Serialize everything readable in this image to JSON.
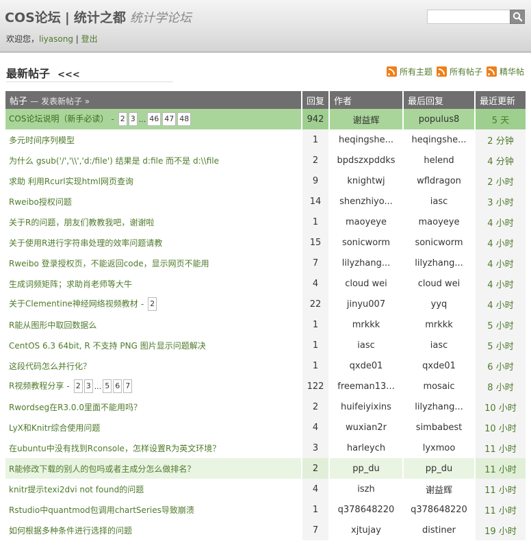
{
  "header": {
    "brand": "COS论坛",
    "separator": "|",
    "subtitle": "统计之都",
    "slogan": "统计学论坛",
    "welcome": "欢迎您，",
    "username": "liyasong",
    "divider": "|",
    "logout": "登出",
    "search_placeholder": ""
  },
  "section": {
    "title": "最新帖子",
    "more": "<<<"
  },
  "feeds": [
    {
      "label": "所有主题"
    },
    {
      "label": "所有帖子"
    },
    {
      "label": "精华帖"
    }
  ],
  "table": {
    "columns": {
      "topic": "帖子",
      "new_post": "— 发表新帖子 »",
      "replies": "回复",
      "author": "作者",
      "last_reply": "最后回复",
      "updated": "最近更新"
    },
    "rows": [
      {
        "title": "COS论坛说明（新手必读）",
        "pages": [
          "2",
          "3",
          "...",
          "46",
          "47",
          "48"
        ],
        "replies": "942",
        "author": "谢益辉",
        "last": "populus8",
        "updated": "5 天",
        "style": "pinned"
      },
      {
        "title": "多元时间序列模型",
        "pages": [],
        "replies": "1",
        "author": "heqingshe...",
        "last": "heqingshe...",
        "updated": "2 分钟",
        "style": ""
      },
      {
        "title": "为什么 gsub('/','\\\\','d:/file') 结果是 d:file 而不是 d:\\\\file",
        "pages": [],
        "replies": "2",
        "author": "bpdszxpddks",
        "last": "helend",
        "updated": "4 分钟",
        "style": ""
      },
      {
        "title": "求助 利用Rcurl实现html网页查询",
        "pages": [],
        "replies": "9",
        "author": "knightwj",
        "last": "wfldragon",
        "updated": "2 小时",
        "style": ""
      },
      {
        "title": "Rweibo授权问题",
        "pages": [],
        "replies": "14",
        "author": "shenzhiyo...",
        "last": "iasc",
        "updated": "3 小时",
        "style": ""
      },
      {
        "title": "关于R的问题，朋友们教教我吧，谢谢啦",
        "pages": [],
        "replies": "1",
        "author": "maoyeye",
        "last": "maoyeye",
        "updated": "4 小时",
        "style": ""
      },
      {
        "title": "关于使用R进行字符串处理的效率问题请教",
        "pages": [],
        "replies": "15",
        "author": "sonicworm",
        "last": "sonicworm",
        "updated": "4 小时",
        "style": ""
      },
      {
        "title": "Rweibo 登录授权页，不能返回code，显示网页不能用",
        "pages": [],
        "replies": "7",
        "author": "lilyzhang...",
        "last": "lilyzhang...",
        "updated": "4 小时",
        "style": ""
      },
      {
        "title": "生成词频矩阵；求助肖老师等大牛",
        "pages": [],
        "replies": "4",
        "author": "cloud wei",
        "last": "cloud wei",
        "updated": "4 小时",
        "style": ""
      },
      {
        "title": "关于Clementine神经网络视频教材",
        "pages": [
          "2"
        ],
        "replies": "22",
        "author": "jinyu007",
        "last": "yyq",
        "updated": "4 小时",
        "style": ""
      },
      {
        "title": "R能从图形中取回数据么",
        "pages": [],
        "replies": "1",
        "author": "mrkkk",
        "last": "mrkkk",
        "updated": "5 小时",
        "style": ""
      },
      {
        "title": "CentOS 6.3 64bit, R 不支持 PNG 图片显示问题解决",
        "pages": [],
        "replies": "1",
        "author": "iasc",
        "last": "iasc",
        "updated": "5 小时",
        "style": ""
      },
      {
        "title": "这段代码怎么并行化？",
        "pages": [],
        "replies": "1",
        "author": "qxde01",
        "last": "qxde01",
        "updated": "6 小时",
        "style": ""
      },
      {
        "title": "R视频教程分享",
        "pages": [
          "2",
          "3",
          "...",
          "5",
          "6",
          "7"
        ],
        "replies": "122",
        "author": "freeman13...",
        "last": "mosaic",
        "updated": "8 小时",
        "style": ""
      },
      {
        "title": "Rwordseg在R3.0.0里面不能用吗？",
        "pages": [],
        "replies": "2",
        "author": "huifeiyixins",
        "last": "lilyzhang...",
        "updated": "10 小时",
        "style": ""
      },
      {
        "title": "LyX和Knitr综合使用问题",
        "pages": [],
        "replies": "4",
        "author": "wuxian2r",
        "last": "simbabest",
        "updated": "10 小时",
        "style": ""
      },
      {
        "title": "在ubuntu中没有找到Rconsole，怎样设置R为英文环境？",
        "pages": [],
        "replies": "3",
        "author": "harleych",
        "last": "lyxmoo",
        "updated": "11 小时",
        "style": ""
      },
      {
        "title": "R能修改下载的别人的包吗或者主成分怎么做排名？",
        "pages": [],
        "replies": "2",
        "author": "pp_du",
        "last": "pp_du",
        "updated": "11 小时",
        "style": "highlight"
      },
      {
        "title": "knitr提示texi2dvi not found的问题",
        "pages": [],
        "replies": "4",
        "author": "iszh",
        "last": "谢益辉",
        "updated": "11 小时",
        "style": ""
      },
      {
        "title": "Rstudio中quantmod包调用chartSeries导致崩溃",
        "pages": [],
        "replies": "1",
        "author": "q378648220",
        "last": "q378648220",
        "updated": "11 小时",
        "style": ""
      },
      {
        "title": "如何根据多种条件进行选择的问题",
        "pages": [],
        "replies": "7",
        "author": "xjtujay",
        "last": "distiner",
        "updated": "19 小时",
        "style": ""
      }
    ]
  },
  "colors": {
    "link_green": "#4e7a2b",
    "header_gray": "#6f6f6f",
    "pinned_green": "#a9d59a",
    "highlight_green": "#e9f4e2",
    "rss_orange": "#f07f1b"
  }
}
